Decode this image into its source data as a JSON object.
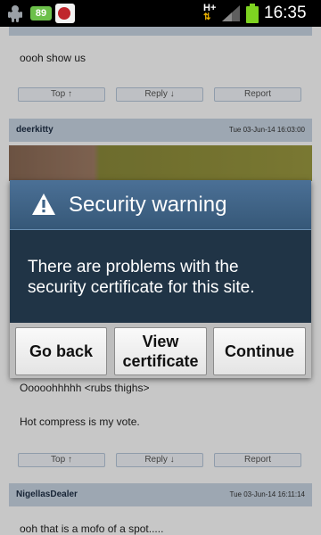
{
  "status_bar": {
    "battery_badge": "89",
    "network": "H+",
    "network_arrows": "⇅",
    "time": "16:35"
  },
  "posts": [
    {
      "author": "",
      "date": "",
      "text": "oooh show us",
      "actions": [
        "Top ↑",
        "Reply ↓",
        "Report"
      ]
    },
    {
      "author": "deerkitty",
      "date": "Tue 03-Jun-14 16:03:00",
      "text_lines": [
        "Ooooohhhhh <rubs thighs>",
        "Hot compress is my vote."
      ],
      "actions": [
        "Top ↑",
        "Reply ↓",
        "Report"
      ]
    },
    {
      "author": "NigellasDealer",
      "date": "Tue 03-Jun-14 16:11:14",
      "text": "ooh that is a mofo of a spot....."
    }
  ],
  "dialog": {
    "title": "Security warning",
    "message": "There are problems with the security certificate for this site.",
    "buttons": {
      "go_back": "Go back",
      "view_line1": "View",
      "view_line2": "certificate",
      "continue": "Continue"
    }
  },
  "colors": {
    "dialog_body": "#203446",
    "dialog_header": "#3f6488",
    "post_header": "#c9d6e4"
  },
  "icons": {
    "status_app_1": "android-robot-icon",
    "status_app_3": "app-notification-icon",
    "signal": "signal-icon",
    "battery": "battery-icon",
    "dialog": "warning-triangle-icon"
  }
}
